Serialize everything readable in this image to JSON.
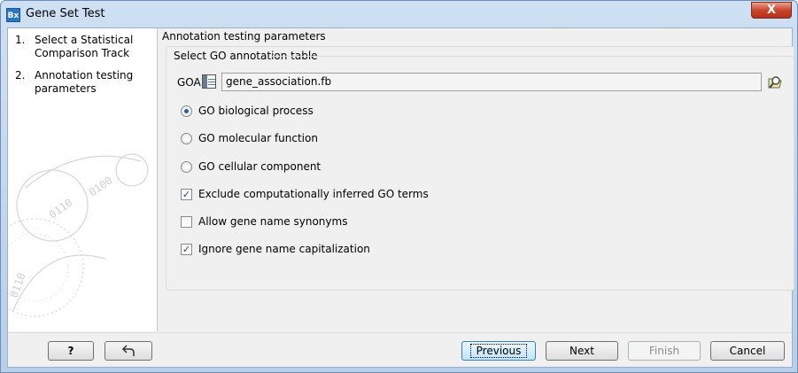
{
  "window": {
    "title": "Gene Set Test",
    "app_icon_text": "Bx",
    "close_glyph": "X"
  },
  "steps": [
    {
      "num": "1.",
      "label": "Select a Statistical Comparison Track"
    },
    {
      "num": "2.",
      "label": "Annotation testing parameters"
    }
  ],
  "panel": {
    "group_title": "Annotation testing parameters",
    "inner_title": "Select GO annotation table",
    "goa_label": "GOA",
    "goa_value": "gene_association.fb"
  },
  "options": {
    "radios": [
      {
        "label": "GO biological process",
        "checked": true
      },
      {
        "label": "GO molecular function",
        "checked": false
      },
      {
        "label": "GO cellular component",
        "checked": false
      }
    ],
    "checkboxes": [
      {
        "label": "Exclude computationally inferred GO terms",
        "checked": true
      },
      {
        "label": "Allow gene name synonyms",
        "checked": false
      },
      {
        "label": "Ignore gene name capitalization",
        "checked": true
      }
    ]
  },
  "buttons": {
    "help": "?",
    "previous": "Previous",
    "next": "Next",
    "finish": "Finish",
    "cancel": "Cancel"
  },
  "icons": {
    "app": "bx-app-icon",
    "close": "close-icon",
    "table": "table-icon",
    "browse": "browse-icon",
    "back": "undo-icon"
  }
}
